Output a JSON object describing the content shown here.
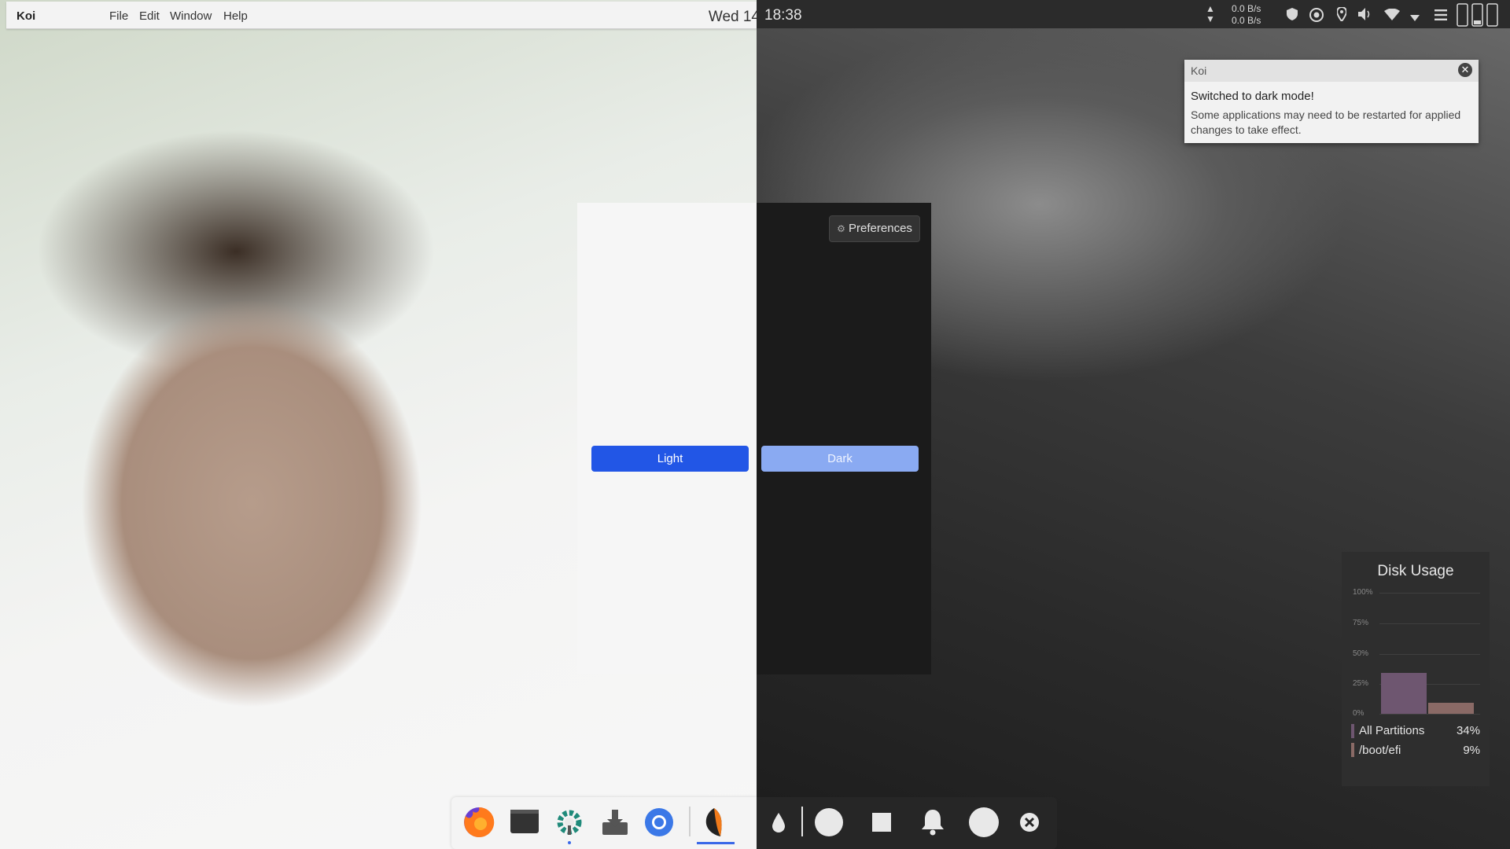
{
  "topbar": {
    "app_name": "Koi",
    "menu": [
      "File",
      "Edit",
      "Window",
      "Help"
    ],
    "clock_date": "Wed 14",
    "clock_time": "18:38"
  },
  "tray": {
    "net_up": "0.0 B/s",
    "net_down": "0.0 B/s",
    "icons": [
      "shield-icon",
      "chrome-tray-icon",
      "location-icon",
      "volume-icon",
      "wifi-icon",
      "dropdown-icon",
      "hamburger-icon",
      "battery-icon"
    ]
  },
  "notification": {
    "app": "Koi",
    "title": "Switched to dark mode!",
    "body": "Some applications may need to be restarted for applied changes to take effect."
  },
  "koi_window": {
    "preferences_label": "Preferences",
    "light_label": "Light",
    "dark_label": "Dark"
  },
  "disk_usage": {
    "title": "Disk Usage",
    "ticks": [
      "100%",
      "75%",
      "50%",
      "25%",
      "0%"
    ],
    "colors": {
      "all": "#6e5670",
      "boot": "#8a6a66"
    },
    "chart_data": {
      "type": "bar",
      "categories": [
        "All Partitions",
        "/boot/efi"
      ],
      "values": [
        34,
        9
      ],
      "ylim": [
        0,
        100
      ]
    },
    "legend": [
      {
        "label": "All Partitions",
        "value": "34%"
      },
      {
        "label": "/boot/efi",
        "value": "9%"
      }
    ]
  },
  "dock": {
    "light_apps": [
      "firefox-icon",
      "terminal-icon",
      "settings-gear-icon",
      "downloads-icon",
      "chromium-icon",
      "koi-icon"
    ],
    "dark_apps": [
      "drop-icon",
      "circle-icon",
      "square-icon",
      "bell-icon",
      "circle-icon",
      "close-circle-icon"
    ]
  },
  "colors": {
    "accent": "#2256e6",
    "dark_button": "#8aaaf2"
  }
}
